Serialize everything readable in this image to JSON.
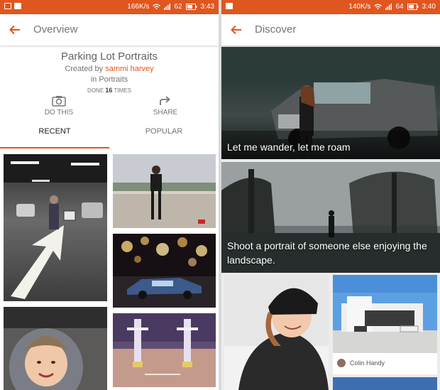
{
  "left_screen": {
    "status": {
      "speed": "166K/s",
      "signal": "62",
      "time": "3:43"
    },
    "appbar": {
      "title": "Overview"
    },
    "project": {
      "title": "Parking Lot Portraits",
      "created_prefix": "Created by ",
      "author": "sammi harvey",
      "category": "in Portraits",
      "done_prefix": "DONE ",
      "done_count": "16",
      "done_suffix": " TIMES"
    },
    "actions": {
      "do_this": "DO THIS",
      "share": "SHARE"
    },
    "tabs": [
      {
        "label": "RECENT",
        "active": true
      },
      {
        "label": "POPULAR",
        "active": false
      }
    ],
    "photos": [
      {
        "subject": "parking-garage-arrow"
      },
      {
        "subject": "woman-on-wall"
      },
      {
        "subject": "toy-car-bokeh"
      },
      {
        "subject": "baby-in-carseat"
      },
      {
        "subject": "empty-parking-lot"
      }
    ]
  },
  "right_screen": {
    "status": {
      "speed": "140K/s",
      "signal": "64",
      "time": "3:40"
    },
    "appbar": {
      "title": "Discover"
    },
    "cards": [
      {
        "caption": "Let me wander, let me roam"
      },
      {
        "caption": "Shoot a portrait of someone else enjoying the landscape."
      }
    ],
    "attribution": {
      "name": "Colin Handy"
    }
  },
  "colors": {
    "accent": "#e0561f",
    "status_bar": "#e0561f"
  }
}
